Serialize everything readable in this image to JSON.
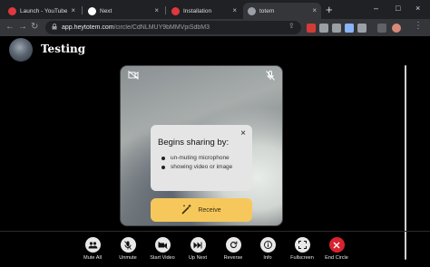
{
  "browser": {
    "tabs": [
      {
        "title": "Launch - YouTube M",
        "favicon_color": "#e0383e",
        "active": false
      },
      {
        "title": "Next",
        "favicon_color": "#ffffff",
        "active": false
      },
      {
        "title": "Installation",
        "favicon_color": "#e0383e",
        "active": false
      },
      {
        "title": "totem",
        "favicon_color": "#9aa0a6",
        "active": true
      }
    ],
    "tab_close_glyph": "×",
    "new_tab_glyph": "+",
    "window_controls": {
      "minimize": "–",
      "maximize": "□",
      "close": "×"
    },
    "nav": {
      "back": "←",
      "forward": "→",
      "reload": "↻"
    },
    "url_host": "app.heytotem.com",
    "url_path": "/circle/CdNLMUY9bMMVpiSdbM3",
    "lock_glyph": "🔒"
  },
  "circle": {
    "title": "Testing"
  },
  "tile": {
    "camera_off_icon": "video-off-icon",
    "mic_off_icon": "mic-off-icon"
  },
  "popup": {
    "heading": "Begins sharing by:",
    "close_glyph": "×",
    "items": [
      "un-muting microphone",
      "showing video or image"
    ]
  },
  "receive_button": {
    "label": "Receive",
    "icon": "magic-wand-icon"
  },
  "controls": [
    {
      "label": "Mute All",
      "icon": "users-icon",
      "glyph": "👥"
    },
    {
      "label": "Unmute",
      "icon": "mic-off-icon",
      "glyph": "🎙"
    },
    {
      "label": "Start Video",
      "icon": "video-off-icon",
      "glyph": "▶"
    },
    {
      "label": "Up Next",
      "icon": "skip-next-icon",
      "glyph": "⏭"
    },
    {
      "label": "Reverse",
      "icon": "reverse-icon",
      "glyph": "↻"
    },
    {
      "label": "Info",
      "icon": "info-icon",
      "glyph": "i"
    },
    {
      "label": "Fullscreen",
      "icon": "fullscreen-icon",
      "glyph": "⛶"
    },
    {
      "label": "End Circle",
      "icon": "close-icon",
      "glyph": "✕"
    }
  ],
  "colors": {
    "receive_button": "#f6c85c",
    "end_circle": "#d9232e",
    "popup_bg": "#e5e5e5"
  }
}
